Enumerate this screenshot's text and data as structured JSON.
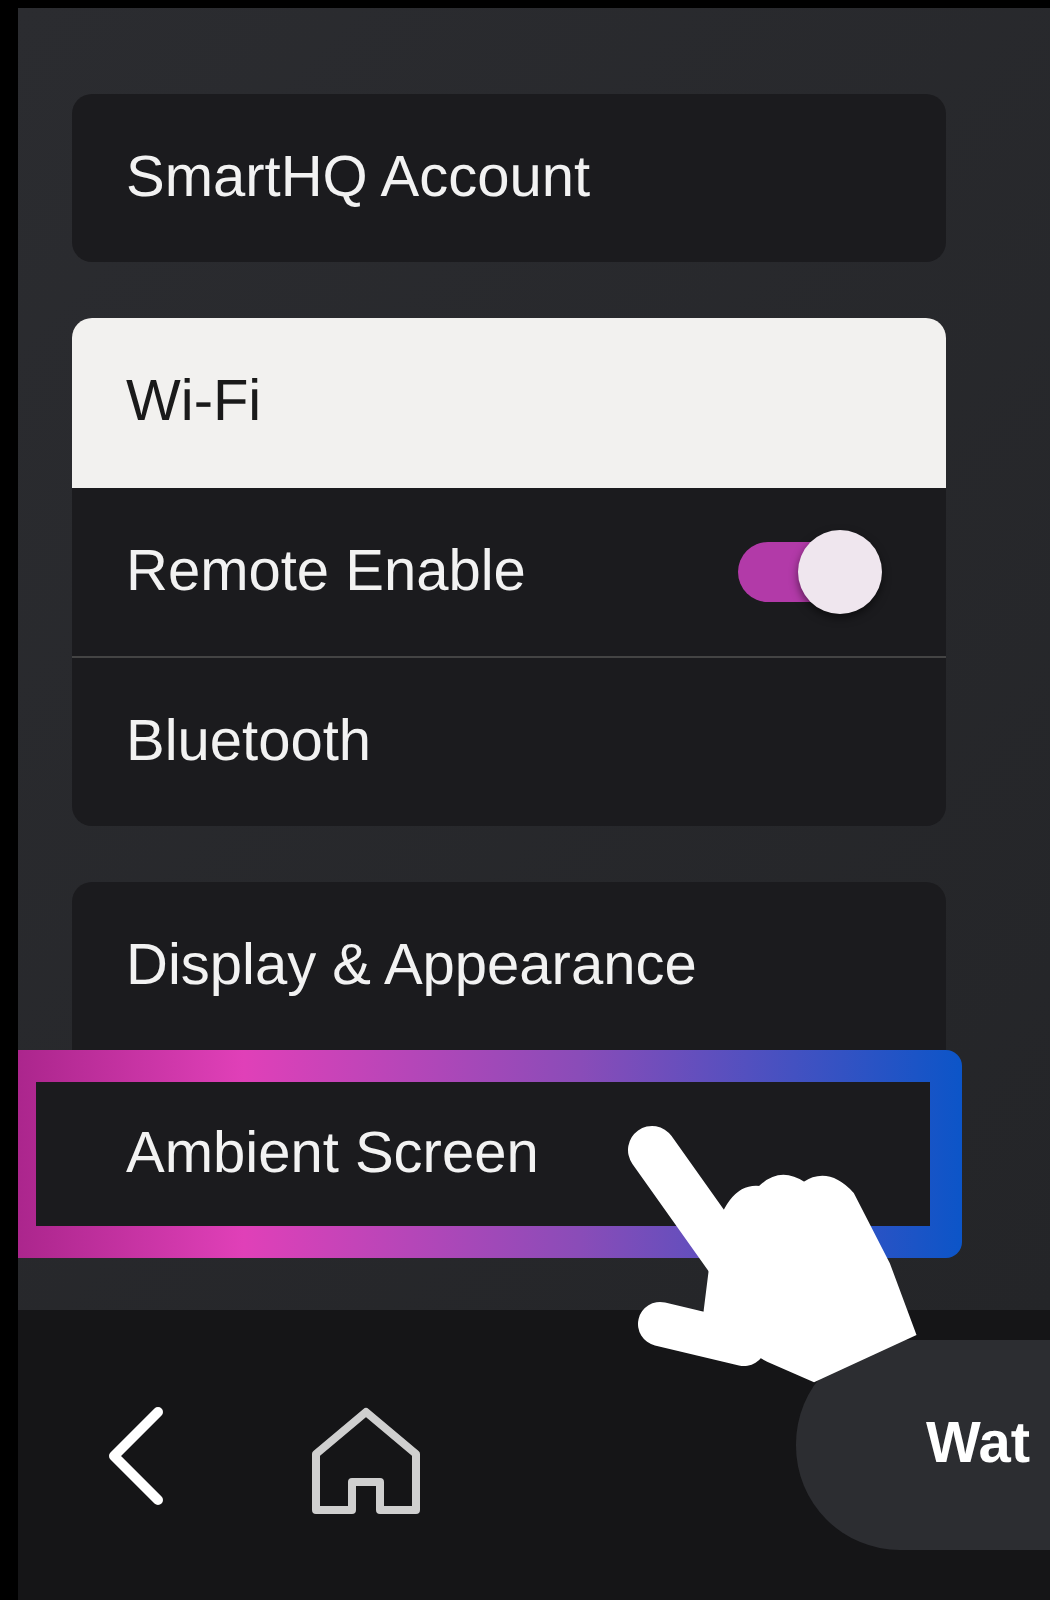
{
  "groups": [
    {
      "items": [
        {
          "label": "SmartHQ Account",
          "kind": "link",
          "selected": false,
          "highlighted": false
        }
      ]
    },
    {
      "items": [
        {
          "label": "Wi-Fi",
          "kind": "link",
          "selected": true,
          "highlighted": false
        },
        {
          "label": "Remote Enable",
          "kind": "toggle",
          "on": true,
          "selected": false,
          "highlighted": false
        },
        {
          "label": "Bluetooth",
          "kind": "link",
          "selected": false,
          "highlighted": false
        }
      ]
    },
    {
      "items": [
        {
          "label": "Display & Appearance",
          "kind": "link",
          "selected": false,
          "highlighted": false
        },
        {
          "label": "Ambient Screen",
          "kind": "link",
          "selected": false,
          "highlighted": true
        }
      ]
    }
  ],
  "bottom_bar": {
    "action_button": "Wat"
  }
}
